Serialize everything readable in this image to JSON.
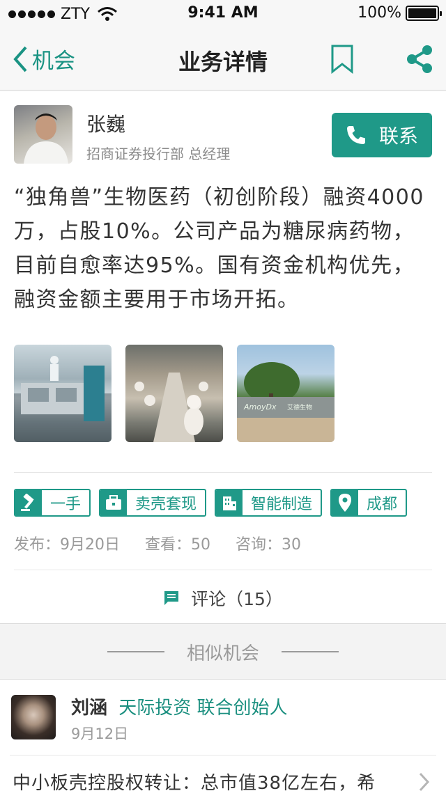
{
  "status_bar": {
    "carrier": "ZTY",
    "time": "9:41 AM",
    "battery": "100%",
    "battery_level": 1.0
  },
  "nav": {
    "back_label": "机会",
    "title": "业务详情"
  },
  "poster": {
    "name": "张巍",
    "org": "招商证券投行部 总经理",
    "contact_label": "联系"
  },
  "description": "“独角兽”生物医药（初创阶段）融资4000万，占股10%。公司产品为糖尿病药物，目前自愈率达95%。国有资金机构优先，融资金额主要用于市场开拓。",
  "photos": [
    {
      "name": "photo-factory-machines"
    },
    {
      "name": "photo-production-line"
    },
    {
      "name": "photo-company-sign",
      "sign_text": "AmoyDx 艾德生物"
    }
  ],
  "tags": [
    {
      "icon": "gavel-icon",
      "label": "一手"
    },
    {
      "icon": "briefcase-icon",
      "label": "卖壳套现"
    },
    {
      "icon": "building-icon",
      "label": "智能制造"
    },
    {
      "icon": "location-pin-icon",
      "label": "成都"
    }
  ],
  "stats": {
    "published": "发布：9月20日",
    "views": "查看：50",
    "inquiries": "咨询：30"
  },
  "comments": {
    "label": "评论（15）"
  },
  "similar_header": "相似机会",
  "similar_item": {
    "name": "刘涵",
    "org": "天际投资 联合创始人",
    "date": "9月12日",
    "text": "中小板壳控股权转让：总市值38亿左右，希"
  },
  "colors": {
    "accent": "#1f9988",
    "muted": "#9a9a9a"
  }
}
